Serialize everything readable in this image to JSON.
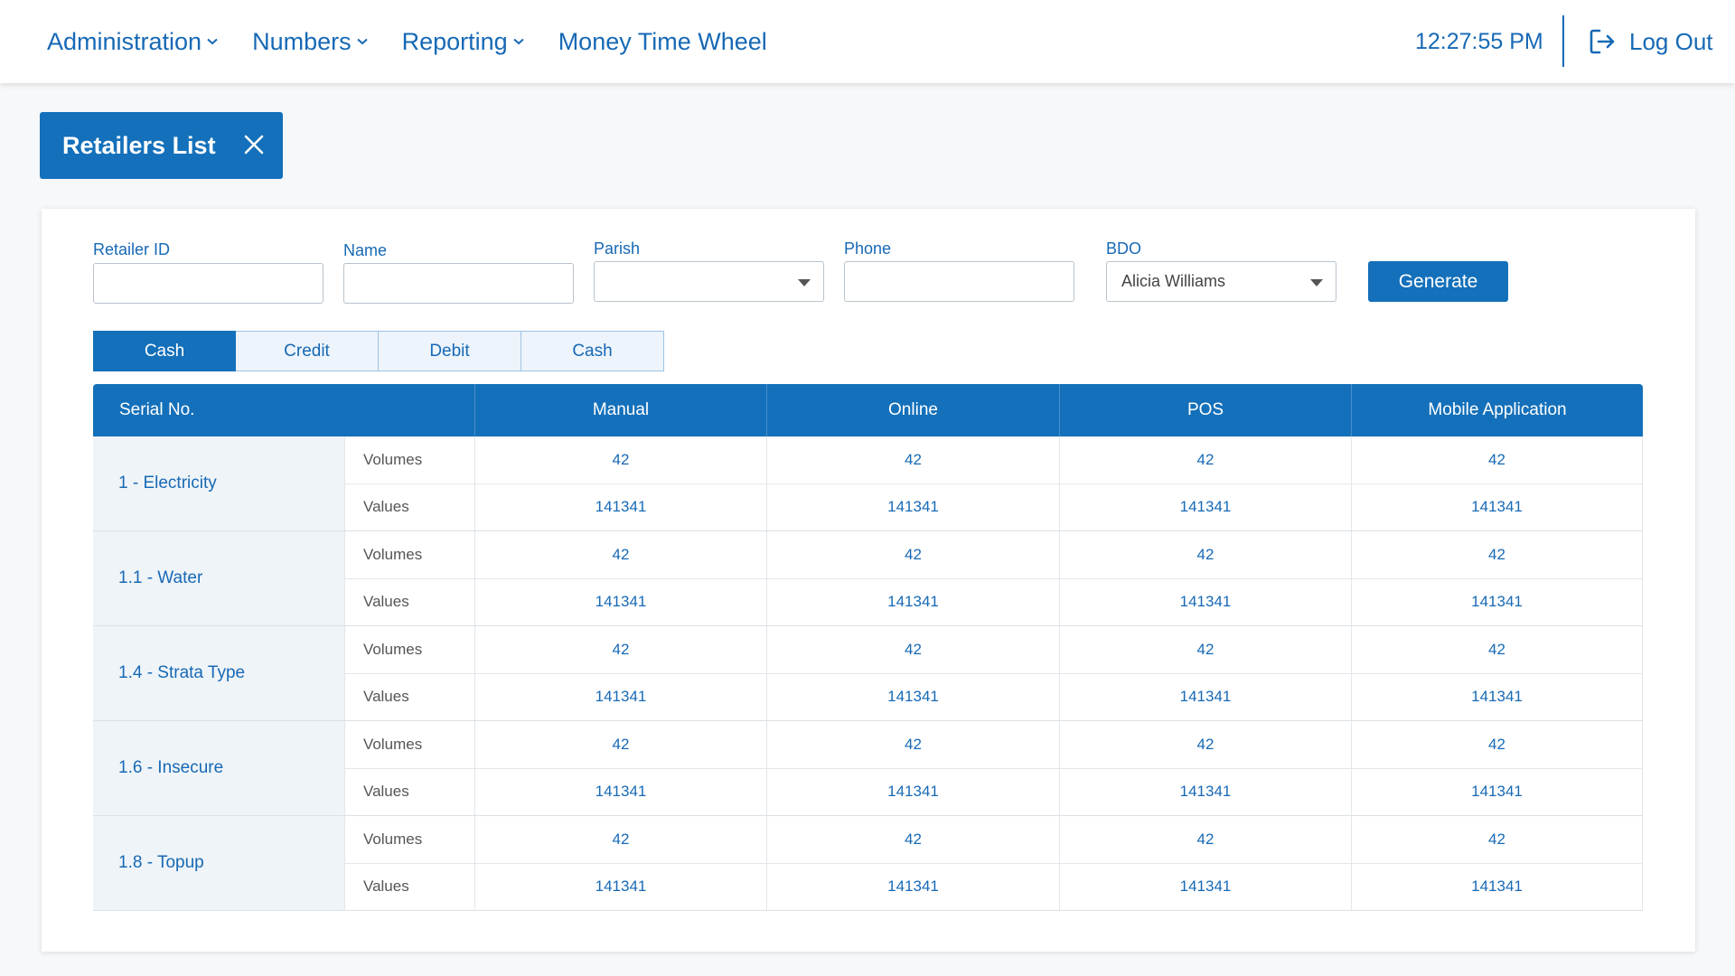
{
  "nav": {
    "items": [
      {
        "label": "Administration",
        "has_dropdown": true
      },
      {
        "label": "Numbers",
        "has_dropdown": true
      },
      {
        "label": "Reporting",
        "has_dropdown": true
      },
      {
        "label": "Money Time Wheel",
        "has_dropdown": false
      }
    ],
    "clock": "12:27:55 PM",
    "logout_label": "Log Out"
  },
  "page_tab": {
    "title": "Retailers List"
  },
  "filters": {
    "retailer_id": {
      "label": "Retailer ID",
      "value": ""
    },
    "name": {
      "label": "Name",
      "value": ""
    },
    "parish": {
      "label": "Parish",
      "value": ""
    },
    "phone": {
      "label": "Phone",
      "value": ""
    },
    "bdo": {
      "label": "BDO",
      "value": "Alicia Williams"
    },
    "generate_label": "Generate"
  },
  "tabs": [
    {
      "label": "Cash",
      "active": true
    },
    {
      "label": "Credit",
      "active": false
    },
    {
      "label": "Debit",
      "active": false
    },
    {
      "label": "Cash",
      "active": false
    }
  ],
  "table": {
    "headers": [
      "Serial No.",
      "Manual",
      "Online",
      "POS",
      "Mobile Application"
    ],
    "groups": [
      {
        "serial": "1 - Electricity",
        "rows": [
          {
            "label": "Volumes",
            "values": [
              "42",
              "42",
              "42",
              "42"
            ]
          },
          {
            "label": "Values",
            "values": [
              "141341",
              "141341",
              "141341",
              "141341"
            ]
          }
        ]
      },
      {
        "serial": "1.1 - Water",
        "rows": [
          {
            "label": "Volumes",
            "values": [
              "42",
              "42",
              "42",
              "42"
            ]
          },
          {
            "label": "Values",
            "values": [
              "141341",
              "141341",
              "141341",
              "141341"
            ]
          }
        ]
      },
      {
        "serial": "1.4 - Strata Type",
        "rows": [
          {
            "label": "Volumes",
            "values": [
              "42",
              "42",
              "42",
              "42"
            ]
          },
          {
            "label": "Values",
            "values": [
              "141341",
              "141341",
              "141341",
              "141341"
            ]
          }
        ]
      },
      {
        "serial": "1.6 - Insecure",
        "rows": [
          {
            "label": "Volumes",
            "values": [
              "42",
              "42",
              "42",
              "42"
            ]
          },
          {
            "label": "Values",
            "values": [
              "141341",
              "141341",
              "141341",
              "141341"
            ]
          }
        ]
      },
      {
        "serial": "1.8 - Topup",
        "rows": [
          {
            "label": "Volumes",
            "values": [
              "42",
              "42",
              "42",
              "42"
            ]
          },
          {
            "label": "Values",
            "values": [
              "141341",
              "141341",
              "141341",
              "141341"
            ]
          }
        ]
      }
    ]
  },
  "colors": {
    "primary": "#1470ba",
    "text": "#1769b5"
  }
}
